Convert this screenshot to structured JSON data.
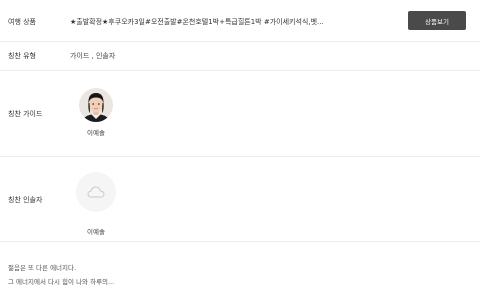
{
  "product": {
    "label": "여행 상품",
    "title": "★출발확정★후쿠오카3일#오전출발#온천호텔1박+특급힐튼1박 #가이세키석식,벳...",
    "button": "상품보기"
  },
  "compliment_type": {
    "label": "칭찬 유형",
    "value": "가이드 , 인솔자"
  },
  "guide": {
    "label": "칭찬 가이드",
    "name": "이예솔"
  },
  "escort": {
    "label": "칭찬 인솔자",
    "name": "이예솔"
  },
  "review": {
    "line1": "젊음은 또 다른 에너지다.",
    "line2": "그 에너지에서 다시 힘이 나와 하루의..."
  },
  "colors": {
    "button_bg": "#4a4a4a",
    "divider": "#ececec"
  },
  "icons": {
    "placeholder": "cloud-icon"
  }
}
